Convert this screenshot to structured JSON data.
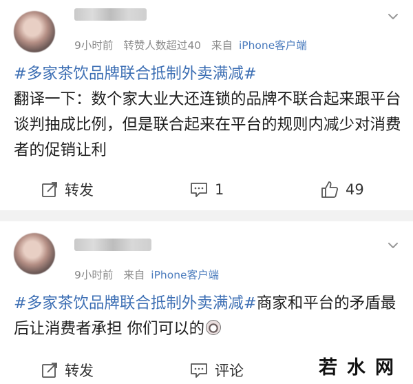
{
  "post1": {
    "time": "9小时前",
    "extra": "转赞人数超过40",
    "source_prefix": "来自",
    "source_device": "iPhone客户端",
    "topic": "#多家茶饮品牌联合抵制外卖满减#",
    "body": "翻译一下：数个家大业大还连锁的品牌不联合起来跟平台谈判抽成比例，但是联合起来在平台的规则内减少对消费者的促销让利",
    "repost_label": "转发",
    "comment_count": "1",
    "like_count": "49"
  },
  "post2": {
    "time": "9小时前",
    "source_prefix": "来自",
    "source_device": "iPhone客户端",
    "topic": "#多家茶饮品牌联合抵制外卖满减#",
    "body": "商家和平台的矛盾最后让消费者承担 你们可以的",
    "repost_label": "转发",
    "comment_label": "评论"
  },
  "watermark": {
    "text": "若水网"
  },
  "colors": {
    "topic": "#3d6fb4",
    "meta": "#8a8a8a",
    "device": "#4a7bbd",
    "divider": "#f2f2f2"
  },
  "icons": [
    "chevron-down-icon",
    "repost-icon",
    "comment-icon",
    "like-icon",
    "emoji-icon"
  ]
}
